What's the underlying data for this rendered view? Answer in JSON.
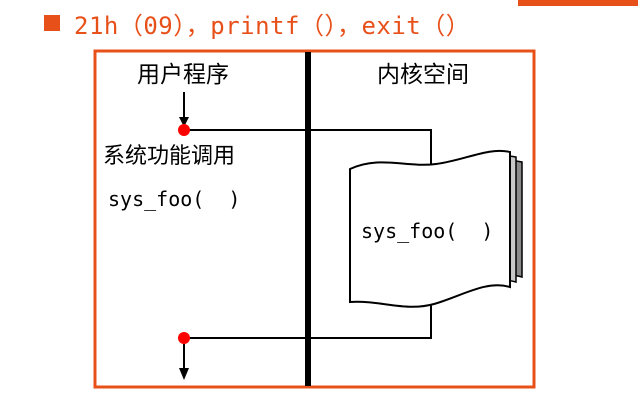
{
  "header": {
    "text": "21h（09），printf（），exit（）"
  },
  "diagram": {
    "left_title": "用户程序",
    "right_title": "内核空间",
    "call_label": "系统功能调用",
    "call_func": "sys_foo(  )",
    "kernel_func": "sys_foo(  )"
  },
  "colors": {
    "accent": "#e8501a",
    "frame": "#e8501a",
    "ink": "#000000",
    "node": "#ff0000",
    "doc_fill": "#ffffff",
    "doc_shadow": "#8a8a8a"
  }
}
